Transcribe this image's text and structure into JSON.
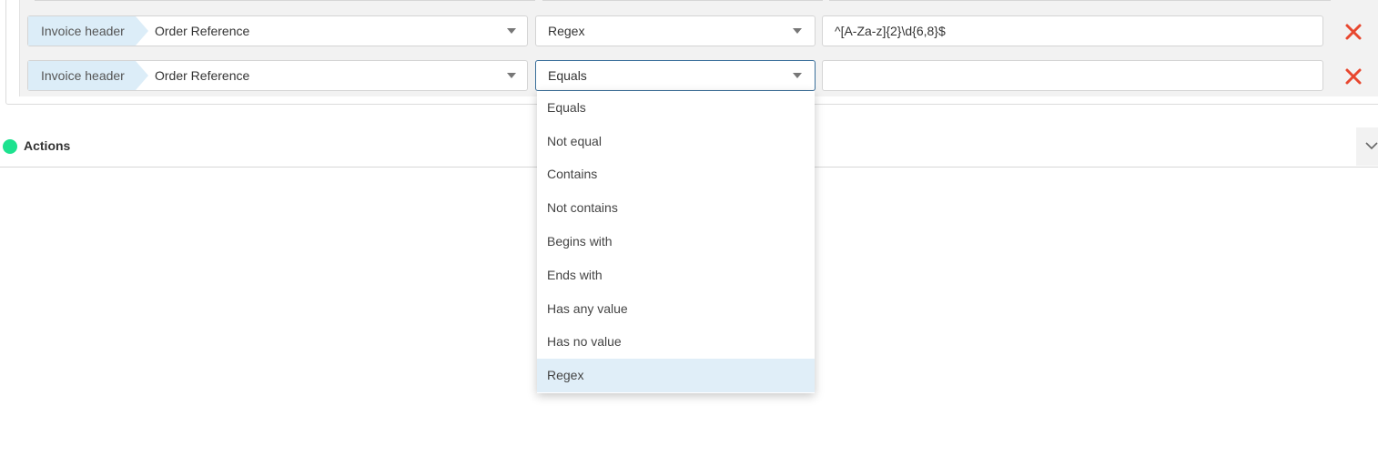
{
  "rows": [
    {
      "tag": "Invoice header",
      "field": "Order Reference",
      "operator": "Regex",
      "value": "^[A-Za-z]{2}\\d{6,8}$"
    },
    {
      "tag": "Invoice header",
      "field": "Order Reference",
      "operator": "Equals",
      "value": ""
    }
  ],
  "actions": {
    "label": "Actions",
    "status_color": "#1de28f"
  },
  "operator_dropdown": {
    "options": [
      "Equals",
      "Not equal",
      "Contains",
      "Not contains",
      "Begins with",
      "Ends with",
      "Has any value",
      "Has no value",
      "Regex"
    ],
    "highlighted": "Regex"
  },
  "icons": {
    "delete": "close-icon",
    "caret": "caret-down-icon",
    "expand": "chevron-down-icon"
  },
  "colors": {
    "delete": "#e8472f",
    "tag_bg": "#dcedf8",
    "focus_border": "#3a6f9a"
  }
}
